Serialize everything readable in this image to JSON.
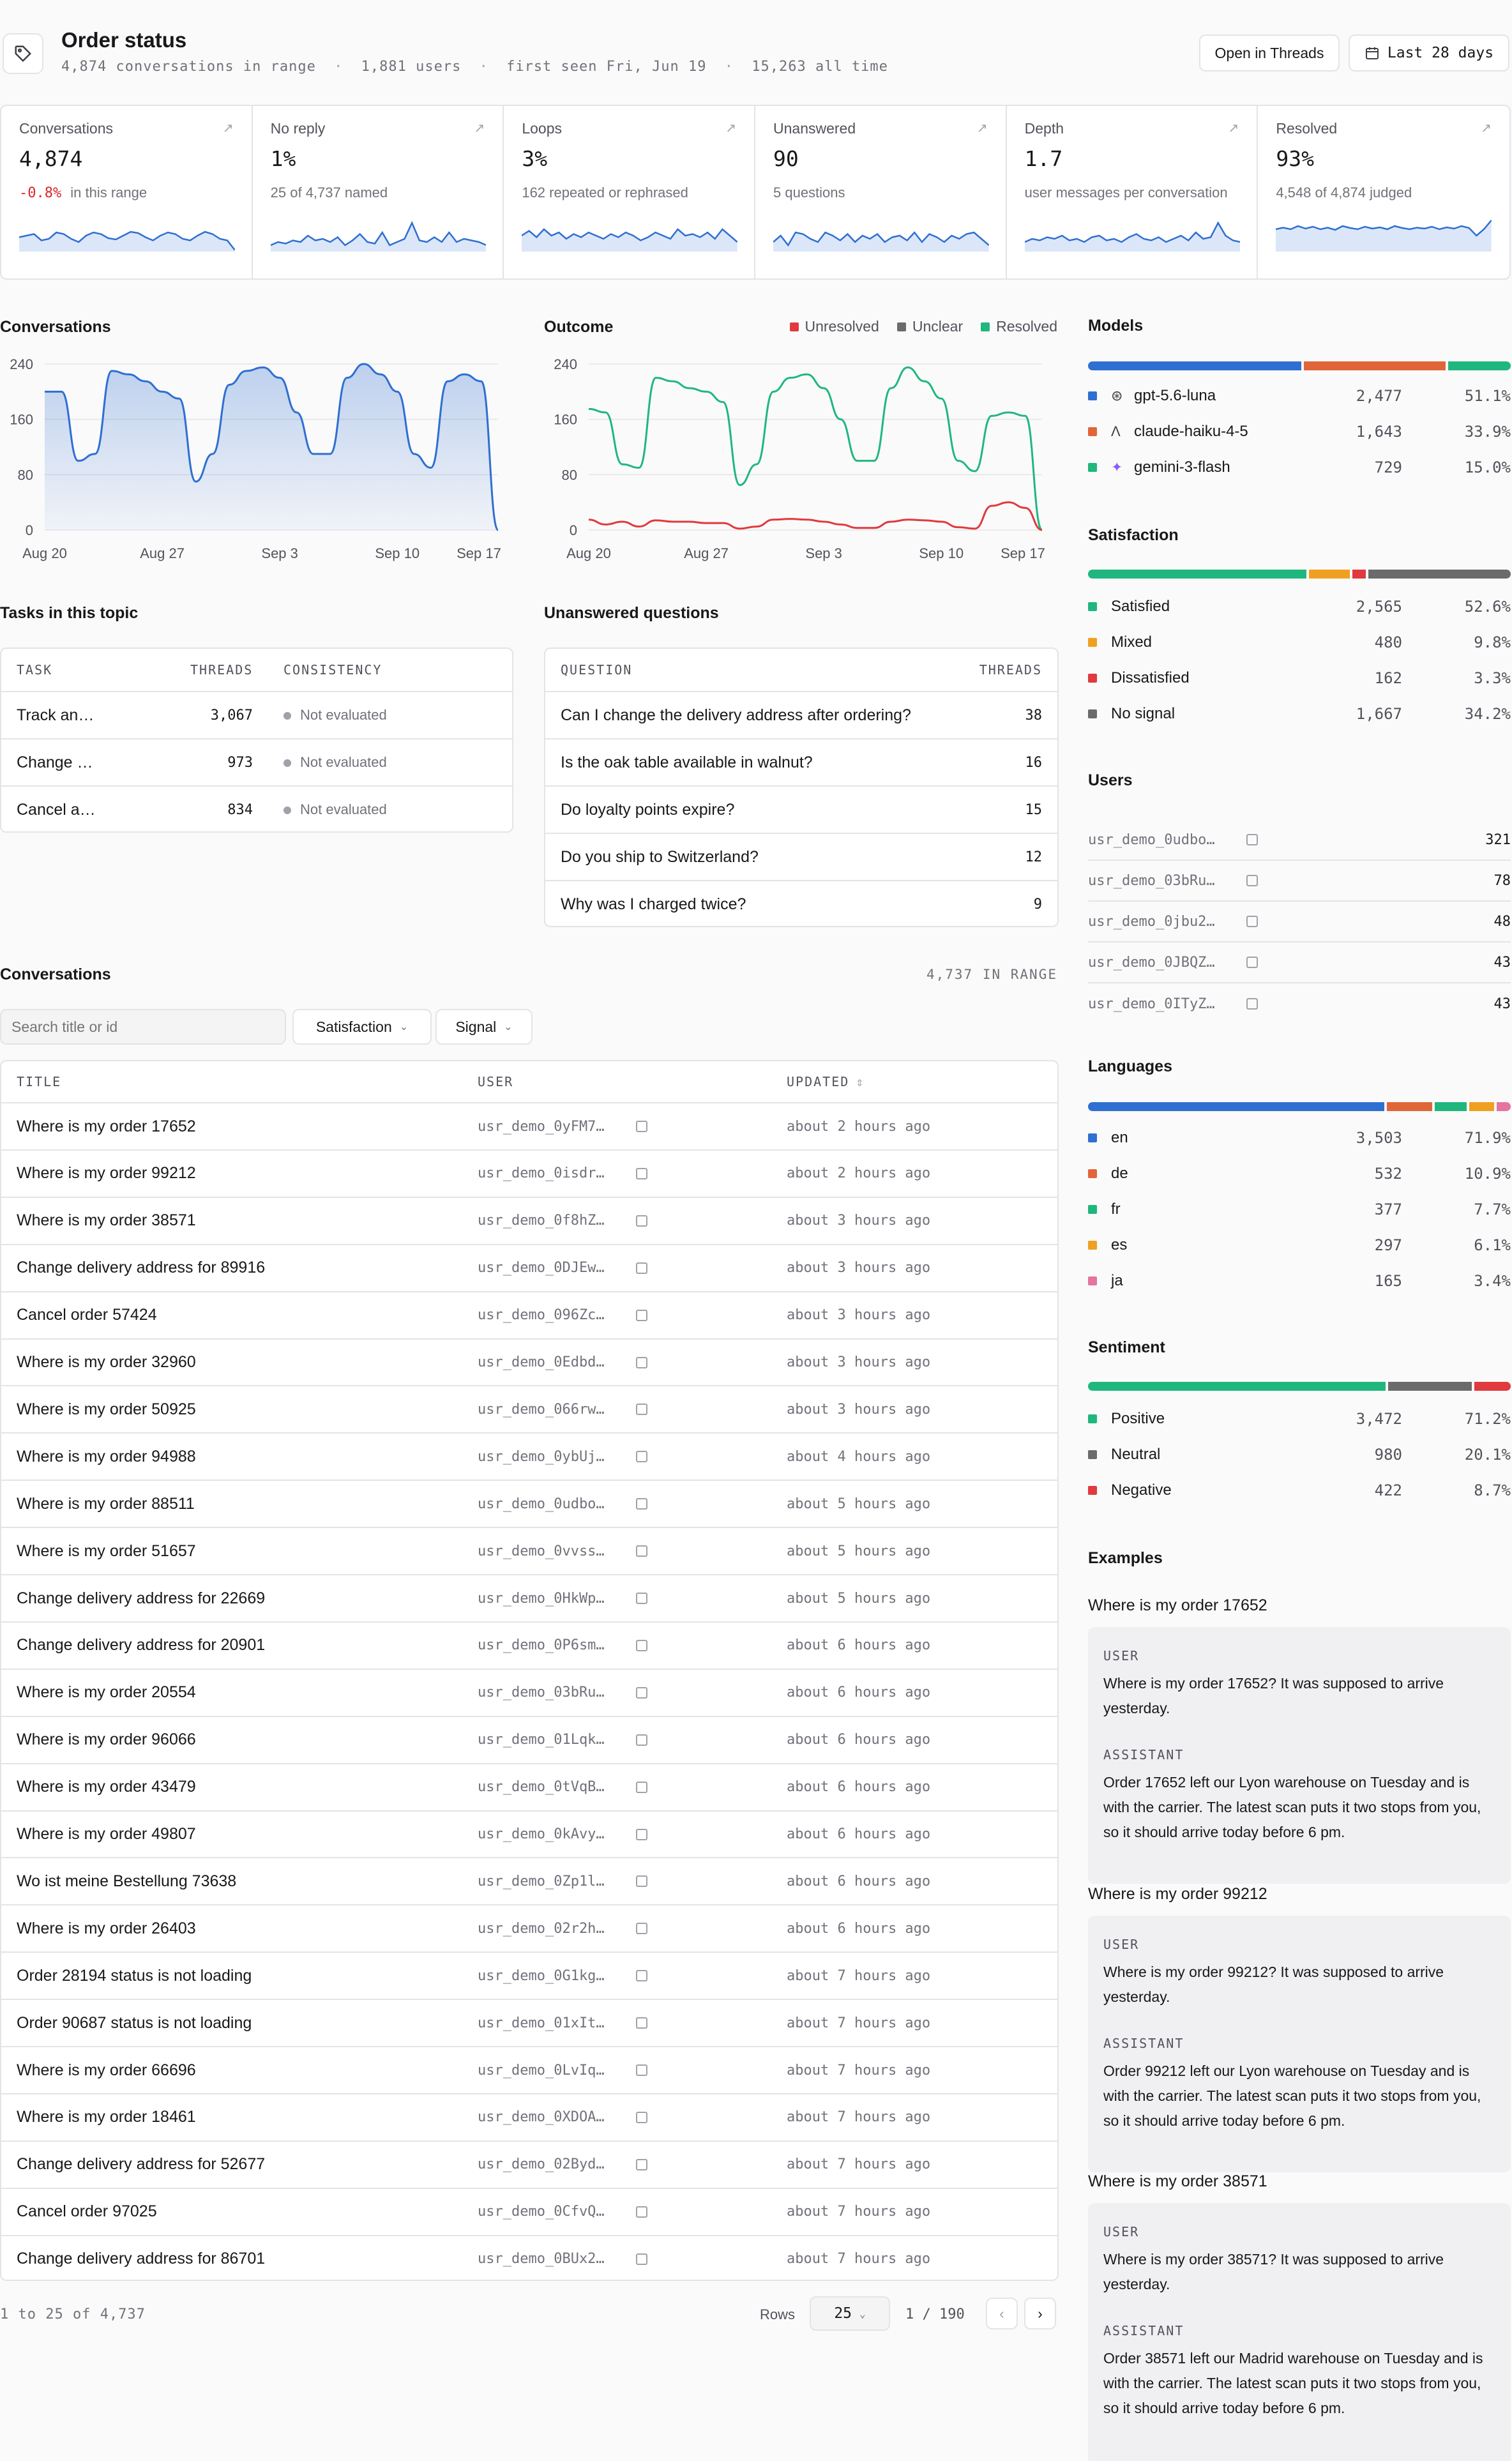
{
  "header": {
    "title": "Order status",
    "meta": [
      "4,874 conversations in range",
      "1,881 users",
      "first seen Fri, Jun 19",
      "15,263 all time"
    ],
    "open_button": "Open in Threads",
    "range_button": "Last 28 days"
  },
  "kpis": [
    {
      "label": "Conversations",
      "value": "4,874",
      "delta": "-0.8%",
      "sub": "in this range",
      "spark": [
        0.45,
        0.5,
        0.55,
        0.35,
        0.4,
        0.6,
        0.55,
        0.4,
        0.3,
        0.5,
        0.6,
        0.55,
        0.42,
        0.38,
        0.5,
        0.62,
        0.58,
        0.45,
        0.35,
        0.5,
        0.6,
        0.55,
        0.4,
        0.35,
        0.5,
        0.62,
        0.55,
        0.4,
        0.35,
        0.05
      ]
    },
    {
      "label": "No reply",
      "value": "1%",
      "sub": "25 of 4,737 named",
      "spark": [
        0.2,
        0.3,
        0.25,
        0.35,
        0.3,
        0.5,
        0.35,
        0.4,
        0.3,
        0.45,
        0.2,
        0.35,
        0.55,
        0.3,
        0.25,
        0.6,
        0.2,
        0.3,
        0.4,
        0.9,
        0.35,
        0.3,
        0.45,
        0.3,
        0.6,
        0.3,
        0.4,
        0.35,
        0.3,
        0.2
      ]
    },
    {
      "label": "Loops",
      "value": "3%",
      "sub": "162 repeated or rephrased",
      "spark": [
        0.5,
        0.65,
        0.45,
        0.7,
        0.5,
        0.6,
        0.4,
        0.55,
        0.45,
        0.6,
        0.5,
        0.4,
        0.55,
        0.45,
        0.6,
        0.5,
        0.35,
        0.45,
        0.6,
        0.5,
        0.4,
        0.7,
        0.5,
        0.55,
        0.45,
        0.6,
        0.4,
        0.7,
        0.5,
        0.3
      ]
    },
    {
      "label": "Unanswered",
      "value": "90",
      "sub": "5 questions",
      "spark": [
        0.3,
        0.5,
        0.2,
        0.6,
        0.55,
        0.4,
        0.3,
        0.6,
        0.5,
        0.35,
        0.55,
        0.3,
        0.5,
        0.4,
        0.55,
        0.3,
        0.45,
        0.5,
        0.35,
        0.6,
        0.3,
        0.55,
        0.45,
        0.3,
        0.5,
        0.4,
        0.55,
        0.6,
        0.4,
        0.2
      ]
    },
    {
      "label": "Depth",
      "value": "1.7",
      "sub": "user messages per conversation",
      "spark": [
        0.3,
        0.4,
        0.35,
        0.45,
        0.4,
        0.5,
        0.35,
        0.4,
        0.3,
        0.45,
        0.5,
        0.35,
        0.4,
        0.3,
        0.45,
        0.55,
        0.4,
        0.35,
        0.45,
        0.3,
        0.4,
        0.5,
        0.35,
        0.6,
        0.4,
        0.45,
        0.9,
        0.5,
        0.35,
        0.3
      ]
    },
    {
      "label": "Resolved",
      "value": "93%",
      "sub": "4,548 of 4,874 judged",
      "spark": [
        0.7,
        0.75,
        0.7,
        0.8,
        0.72,
        0.78,
        0.7,
        0.75,
        0.68,
        0.8,
        0.74,
        0.7,
        0.78,
        0.72,
        0.76,
        0.7,
        0.8,
        0.74,
        0.7,
        0.75,
        0.72,
        0.78,
        0.7,
        0.76,
        0.72,
        0.8,
        0.74,
        0.5,
        0.7,
        0.98
      ]
    }
  ],
  "conversations_chart": {
    "title": "Conversations",
    "type": "area",
    "x_ticks": [
      "Aug 20",
      "Aug 27",
      "Sep 3",
      "Sep 10",
      "Sep 17"
    ],
    "y_ticks": [
      "0",
      "80",
      "160",
      "240"
    ],
    "ylim": [
      0,
      240
    ],
    "values": [
      200,
      200,
      100,
      110,
      230,
      225,
      215,
      200,
      190,
      70,
      110,
      210,
      230,
      235,
      220,
      170,
      110,
      110,
      220,
      240,
      225,
      200,
      110,
      90,
      215,
      225,
      215,
      0
    ]
  },
  "outcome_chart": {
    "title": "Outcome",
    "type": "line",
    "x_ticks": [
      "Aug 20",
      "Aug 27",
      "Sep 3",
      "Sep 10",
      "Sep 17"
    ],
    "y_ticks": [
      "0",
      "80",
      "160",
      "240"
    ],
    "ylim": [
      0,
      240
    ],
    "legend": [
      {
        "name": "Unresolved",
        "color": "#e03a3e"
      },
      {
        "name": "Unclear",
        "color": "#6b6b6b"
      },
      {
        "name": "Resolved",
        "color": "#1fb77e"
      }
    ],
    "series": [
      {
        "name": "Resolved",
        "color": "#1fb77e",
        "values": [
          175,
          170,
          95,
          90,
          220,
          215,
          205,
          200,
          185,
          65,
          95,
          200,
          220,
          225,
          205,
          160,
          100,
          100,
          205,
          235,
          215,
          190,
          100,
          85,
          165,
          170,
          165,
          0
        ]
      },
      {
        "name": "Unresolved",
        "color": "#e03a3e",
        "values": [
          15,
          8,
          12,
          5,
          14,
          12,
          12,
          10,
          10,
          2,
          5,
          15,
          16,
          15,
          12,
          8,
          3,
          3,
          12,
          15,
          14,
          12,
          4,
          2,
          35,
          40,
          32,
          0
        ]
      }
    ]
  },
  "models": {
    "title": "Models",
    "items": [
      {
        "name": "gpt-5.6-luna",
        "count": "2,477",
        "pct": "51.1%",
        "share": 0.511,
        "color": "#2f6fd1",
        "icon": "openai-icon"
      },
      {
        "name": "claude-haiku-4-5",
        "count": "1,643",
        "pct": "33.9%",
        "share": 0.339,
        "color": "#e0663a",
        "icon": "anthropic-icon"
      },
      {
        "name": "gemini-3-flash",
        "count": "729",
        "pct": "15.0%",
        "share": 0.15,
        "color": "#1fb77e",
        "icon": "sparkle-icon"
      }
    ]
  },
  "satisfaction": {
    "title": "Satisfaction",
    "items": [
      {
        "name": "Satisfied",
        "count": "2,565",
        "pct": "52.6%",
        "share": 0.526,
        "color": "#1fb77e"
      },
      {
        "name": "Mixed",
        "count": "480",
        "pct": "9.8%",
        "share": 0.098,
        "color": "#f0a020"
      },
      {
        "name": "Dissatisfied",
        "count": "162",
        "pct": "3.3%",
        "share": 0.033,
        "color": "#e03a3e"
      },
      {
        "name": "No signal",
        "count": "1,667",
        "pct": "34.2%",
        "share": 0.342,
        "color": "#6b6b6b"
      }
    ]
  },
  "users": {
    "title": "Users",
    "items": [
      {
        "id": "usr_demo_0udbo…",
        "count": "321"
      },
      {
        "id": "usr_demo_03bRu…",
        "count": "78"
      },
      {
        "id": "usr_demo_0jbu2…",
        "count": "48"
      },
      {
        "id": "usr_demo_0JBQZ…",
        "count": "43"
      },
      {
        "id": "usr_demo_0ITyZ…",
        "count": "43"
      }
    ]
  },
  "languages": {
    "title": "Languages",
    "items": [
      {
        "name": "en",
        "count": "3,503",
        "pct": "71.9%",
        "share": 0.719,
        "color": "#2f6fd1"
      },
      {
        "name": "de",
        "count": "532",
        "pct": "10.9%",
        "share": 0.109,
        "color": "#e0663a"
      },
      {
        "name": "fr",
        "count": "377",
        "pct": "7.7%",
        "share": 0.077,
        "color": "#1fb77e"
      },
      {
        "name": "es",
        "count": "297",
        "pct": "6.1%",
        "share": 0.061,
        "color": "#f0a020"
      },
      {
        "name": "ja",
        "count": "165",
        "pct": "3.4%",
        "share": 0.034,
        "color": "#e574a0"
      }
    ]
  },
  "sentiment": {
    "title": "Sentiment",
    "items": [
      {
        "name": "Positive",
        "count": "3,472",
        "pct": "71.2%",
        "share": 0.712,
        "color": "#1fb77e"
      },
      {
        "name": "Neutral",
        "count": "980",
        "pct": "20.1%",
        "share": 0.201,
        "color": "#6b6b6b"
      },
      {
        "name": "Negative",
        "count": "422",
        "pct": "8.7%",
        "share": 0.087,
        "color": "#e03a3e"
      }
    ]
  },
  "tasks": {
    "title": "Tasks in this topic",
    "headers": [
      "TASK",
      "THREADS",
      "CONSISTENCY"
    ],
    "rows": [
      {
        "task": "Track an…",
        "threads": "3,067",
        "consistency": "Not evaluated"
      },
      {
        "task": "Change …",
        "threads": "973",
        "consistency": "Not evaluated"
      },
      {
        "task": "Cancel a…",
        "threads": "834",
        "consistency": "Not evaluated"
      }
    ]
  },
  "unanswered": {
    "title": "Unanswered questions",
    "headers": [
      "QUESTION",
      "THREADS"
    ],
    "rows": [
      {
        "q": "Can I change the delivery address after ordering?",
        "n": "38"
      },
      {
        "q": "Is the oak table available in walnut?",
        "n": "16"
      },
      {
        "q": "Do loyalty points expire?",
        "n": "15"
      },
      {
        "q": "Do you ship to Switzerland?",
        "n": "12"
      },
      {
        "q": "Why was I charged twice?",
        "n": "9"
      }
    ]
  },
  "conversations_table": {
    "title": "Conversations",
    "range_count": "4,737 IN RANGE",
    "search_placeholder": "Search title or id",
    "filters": [
      "Satisfaction",
      "Signal"
    ],
    "headers": [
      "TITLE",
      "USER",
      "UPDATED"
    ],
    "rows": [
      {
        "title": "Where is my order 17652",
        "user": "usr_demo_0yFM7…",
        "updated": "about 2 hours ago"
      },
      {
        "title": "Where is my order 99212",
        "user": "usr_demo_0isdr…",
        "updated": "about 2 hours ago"
      },
      {
        "title": "Where is my order 38571",
        "user": "usr_demo_0f8hZ…",
        "updated": "about 3 hours ago"
      },
      {
        "title": "Change delivery address for 89916",
        "user": "usr_demo_0DJEw…",
        "updated": "about 3 hours ago"
      },
      {
        "title": "Cancel order 57424",
        "user": "usr_demo_096Zc…",
        "updated": "about 3 hours ago"
      },
      {
        "title": "Where is my order 32960",
        "user": "usr_demo_0Edbd…",
        "updated": "about 3 hours ago"
      },
      {
        "title": "Where is my order 50925",
        "user": "usr_demo_066rw…",
        "updated": "about 3 hours ago"
      },
      {
        "title": "Where is my order 94988",
        "user": "usr_demo_0ybUj…",
        "updated": "about 4 hours ago"
      },
      {
        "title": "Where is my order 88511",
        "user": "usr_demo_0udbo…",
        "updated": "about 5 hours ago"
      },
      {
        "title": "Where is my order 51657",
        "user": "usr_demo_0vvss…",
        "updated": "about 5 hours ago"
      },
      {
        "title": "Change delivery address for 22669",
        "user": "usr_demo_0HkWp…",
        "updated": "about 5 hours ago"
      },
      {
        "title": "Change delivery address for 20901",
        "user": "usr_demo_0P6sm…",
        "updated": "about 6 hours ago"
      },
      {
        "title": "Where is my order 20554",
        "user": "usr_demo_03bRu…",
        "updated": "about 6 hours ago"
      },
      {
        "title": "Where is my order 96066",
        "user": "usr_demo_01Lqk…",
        "updated": "about 6 hours ago"
      },
      {
        "title": "Where is my order 43479",
        "user": "usr_demo_0tVqB…",
        "updated": "about 6 hours ago"
      },
      {
        "title": "Where is my order 49807",
        "user": "usr_demo_0kAvy…",
        "updated": "about 6 hours ago"
      },
      {
        "title": "Wo ist meine Bestellung 73638",
        "user": "usr_demo_0Zp1l…",
        "updated": "about 6 hours ago"
      },
      {
        "title": "Where is my order 26403",
        "user": "usr_demo_02r2h…",
        "updated": "about 6 hours ago"
      },
      {
        "title": "Order 28194 status is not loading",
        "user": "usr_demo_0G1kg…",
        "updated": "about 7 hours ago"
      },
      {
        "title": "Order 90687 status is not loading",
        "user": "usr_demo_01xIt…",
        "updated": "about 7 hours ago"
      },
      {
        "title": "Where is my order 66696",
        "user": "usr_demo_0LvIq…",
        "updated": "about 7 hours ago"
      },
      {
        "title": "Where is my order 18461",
        "user": "usr_demo_0XDOA…",
        "updated": "about 7 hours ago"
      },
      {
        "title": "Change delivery address for 52677",
        "user": "usr_demo_02Byd…",
        "updated": "about 7 hours ago"
      },
      {
        "title": "Cancel order 97025",
        "user": "usr_demo_0CfvQ…",
        "updated": "about 7 hours ago"
      },
      {
        "title": "Change delivery address for 86701",
        "user": "usr_demo_0BUx2…",
        "updated": "about 7 hours ago"
      }
    ],
    "pagination": {
      "summary": "1 to 25 of 4,737",
      "rows_label": "Rows",
      "rows_value": "25",
      "page": "1 / 190"
    }
  },
  "examples": {
    "title": "Examples",
    "role_user": "USER",
    "role_assistant": "ASSISTANT",
    "items": [
      {
        "title": "Where is my order 17652",
        "user": "Where is my order 17652? It was supposed to arrive yesterday.",
        "assistant": "Order 17652 left our Lyon warehouse on Tuesday and is with the carrier. The latest scan puts it two stops from you, so it should arrive today before 6 pm."
      },
      {
        "title": "Where is my order 99212",
        "user": "Where is my order 99212? It was supposed to arrive yesterday.",
        "assistant": "Order 99212 left our Lyon warehouse on Tuesday and is with the carrier. The latest scan puts it two stops from you, so it should arrive today before 6 pm."
      },
      {
        "title": "Where is my order 38571",
        "user": "Where is my order 38571? It was supposed to arrive yesterday.",
        "assistant": "Order 38571 left our Madrid warehouse on Tuesday and is with the carrier. The latest scan puts it two stops from you, so it should arrive today before 6 pm."
      }
    ]
  }
}
